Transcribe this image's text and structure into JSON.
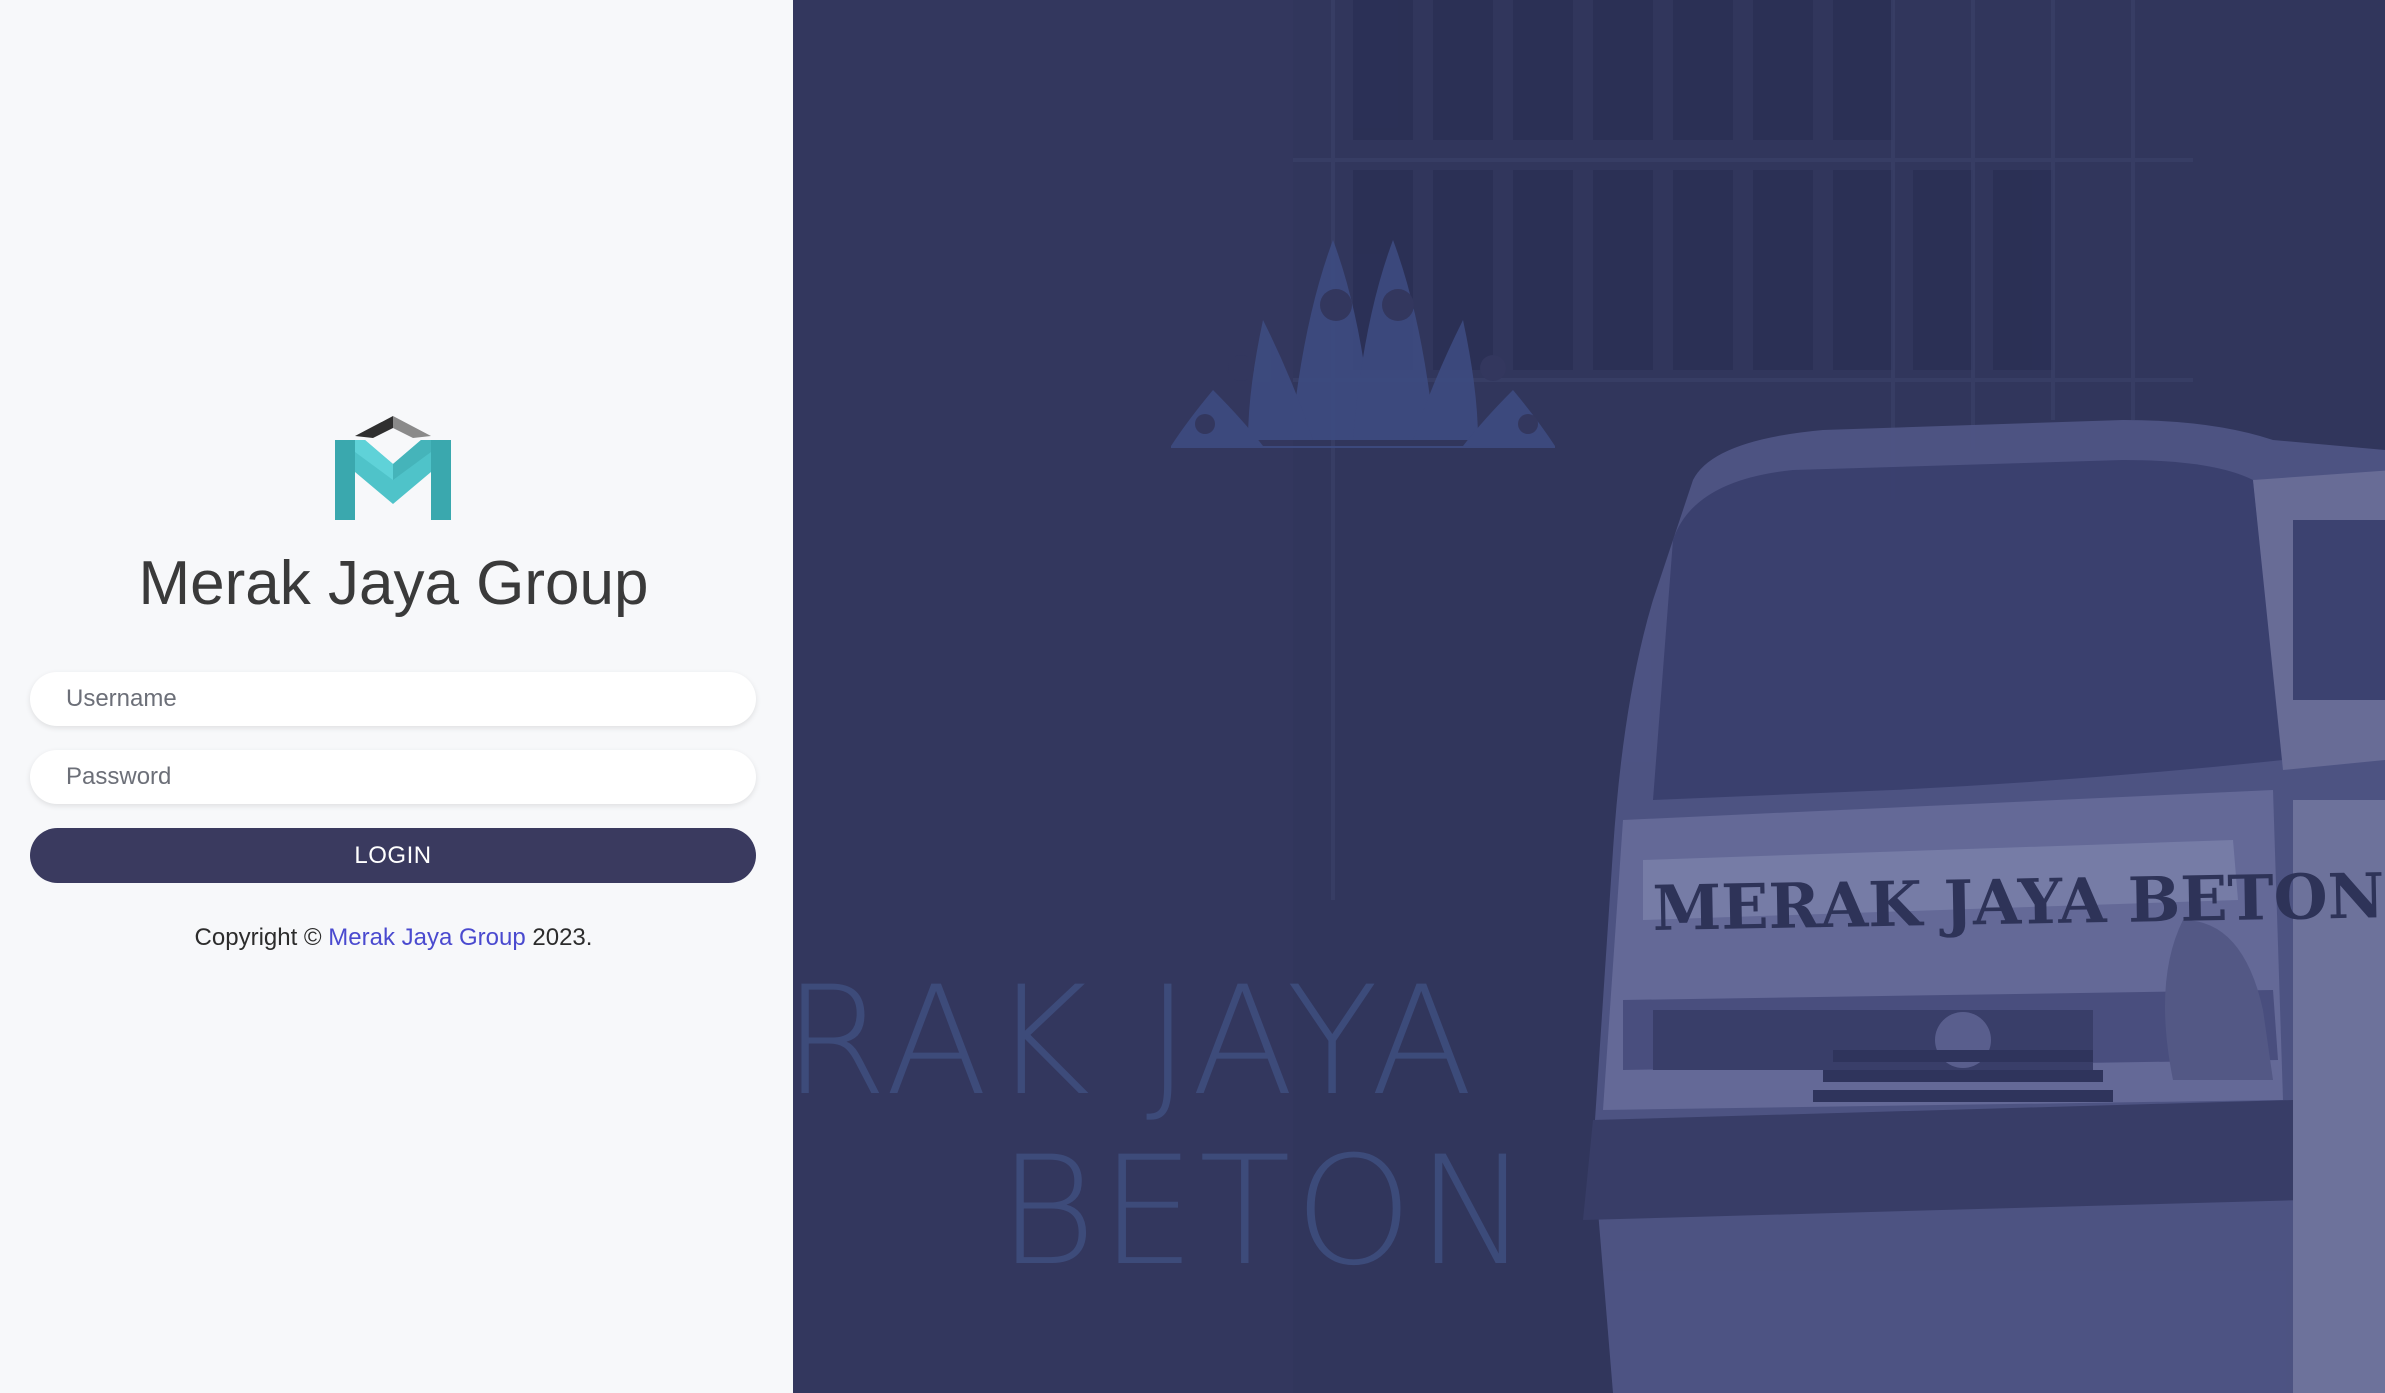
{
  "brand": {
    "name": "Merak Jaya Group"
  },
  "form": {
    "username_placeholder": "Username",
    "password_placeholder": "Password",
    "login_label": "LOGIN"
  },
  "footer": {
    "prefix": "Copyright ©",
    "link_text": "Merak Jaya Group",
    "year": "2023."
  },
  "hero": {
    "line1": "RAK JAYA",
    "line2": "BETON",
    "truck_text": "MERAK JAYA BETON"
  },
  "colors": {
    "panel_bg": "#f7f8fa",
    "hero_bg": "#33375e",
    "button_bg": "#3a3a5f",
    "link": "#4a4acf",
    "logo_teal": "#4fc3c9"
  },
  "icons": {
    "logo": "merak-jaya-m-logo-icon",
    "hero_logo": "peacock-fan-logo-icon"
  }
}
